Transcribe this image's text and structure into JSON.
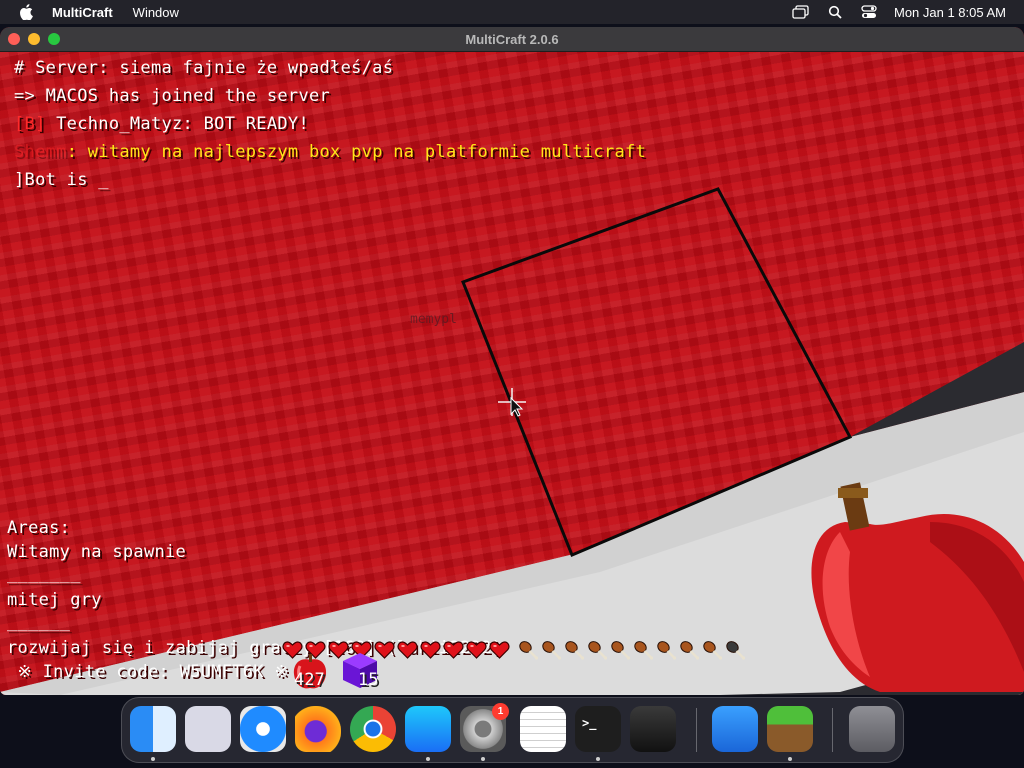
{
  "menubar": {
    "app_name": "MultiCraft",
    "menus": [
      "Window"
    ],
    "clock": "Mon Jan 1  8:05 AM"
  },
  "window": {
    "title": "MultiCraft 2.0.6"
  },
  "chat": {
    "line1": "# Server: siema fajnie że wpadłeś/aś",
    "line2": "=> MACOS has joined the server",
    "line3_prefix": "[B]",
    "line3_text": " Techno_Matyz: BOT READY!",
    "line4_prefix": "Shemm",
    "line4_text": ": witamy na najlepszym box pvp na platformie multicraft",
    "line5": "]Bot is _"
  },
  "nametag": "memypl",
  "sidebar": {
    "title": "Areas:",
    "area1": "Witamy na spawnie",
    "sep1": "_______",
    "area2": "mitej gry",
    "sep2": "______",
    "area3": "rozwijaj się i zabijaj graczy [168] (lukii2232)",
    "invite": " ※ Invite code: W5UMFT6K ※"
  },
  "hotbar": {
    "apple_count": "427",
    "block_count": "15",
    "hearts": 10,
    "hunger_full": 9,
    "hunger_total": 10
  },
  "dock": {
    "items": [
      "Finder",
      "Launchpad",
      "Safari",
      "Firefox",
      "Chrome",
      "App Store",
      "System Settings",
      "TextEdit",
      "Terminal",
      "GarageBand",
      "Weather",
      "MultiCraft",
      "Trash"
    ],
    "settings_badge": "1"
  },
  "colors": {
    "world_red": "#c20d16",
    "floor": "#d9d9d9",
    "chat_yellow": "#ffe619"
  }
}
